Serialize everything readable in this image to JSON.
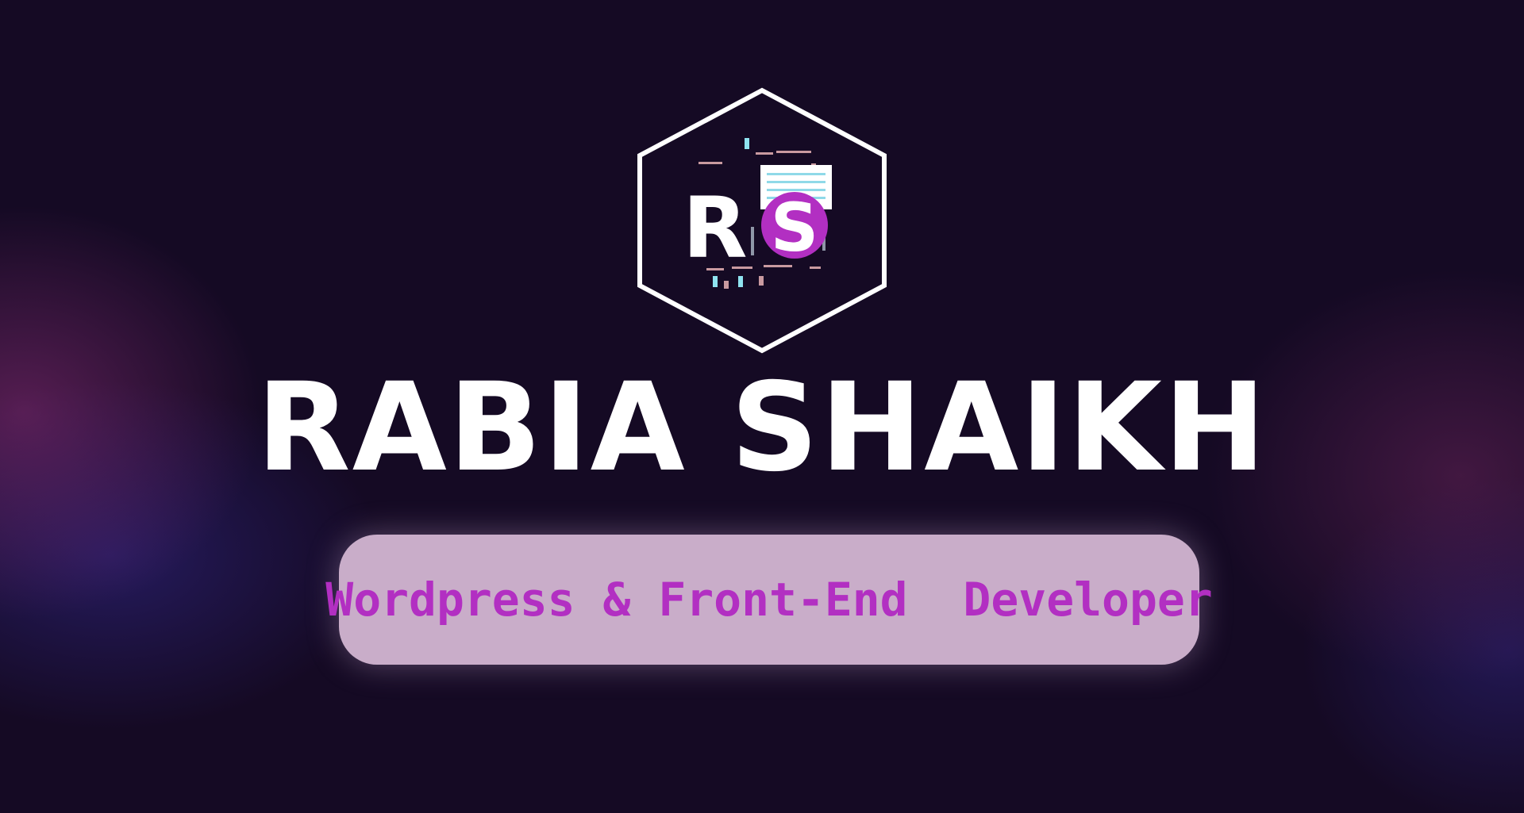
{
  "brand": {
    "logo_icon": "rs-hexagon-logo-icon",
    "name": "RABIA SHAIKH",
    "subtitle": "Wordpress & Front-End  Developer"
  },
  "colors": {
    "background": "#150a24",
    "name_text": "#ffffff",
    "pill_background": "#c9adc9",
    "subtitle_text": "#b22fc2",
    "logo_accent": "#b22fc2"
  }
}
